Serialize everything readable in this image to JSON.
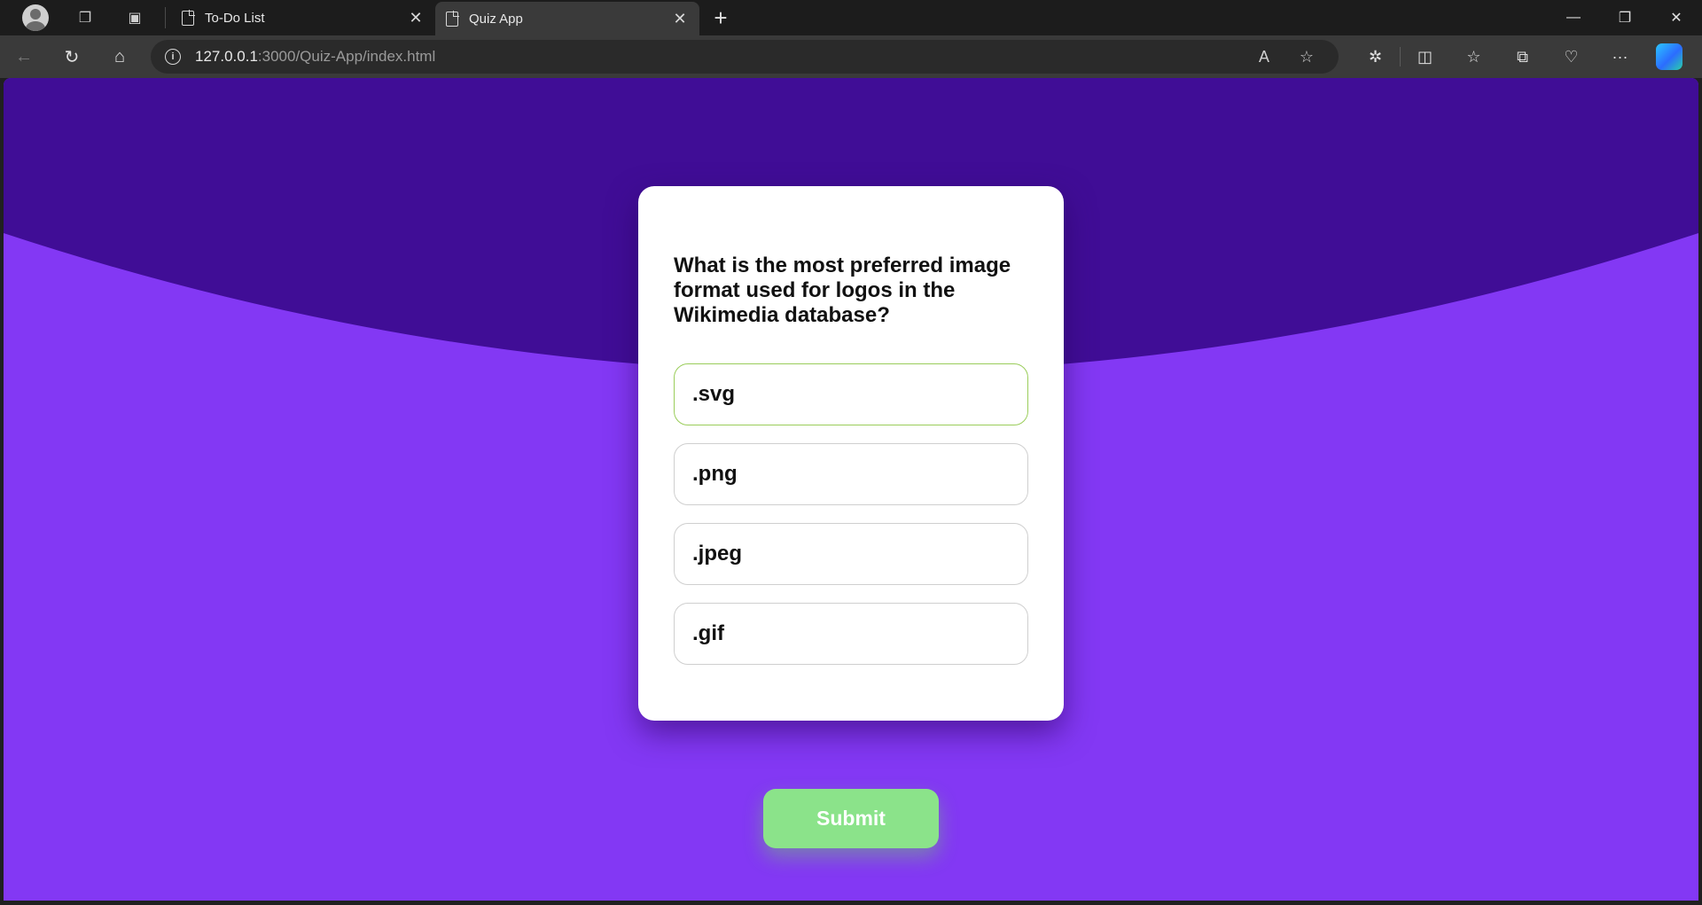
{
  "browser": {
    "tabs": [
      {
        "title": "To-Do List",
        "active": false
      },
      {
        "title": "Quiz App",
        "active": true
      }
    ],
    "new_tab_symbol": "+",
    "close_symbol": "✕",
    "address": {
      "host": "127.0.0.1",
      "path": ":3000/Quiz-App/index.html"
    },
    "icons": [
      "profile-icon",
      "workspaces-icon",
      "tab-actions-icon",
      "back-icon",
      "refresh-icon",
      "home-icon",
      "site-info-icon",
      "read-aloud-icon",
      "favorite-star-icon",
      "extensions-icon",
      "split-screen-icon",
      "favorites-icon",
      "collections-icon",
      "browser-essentials-icon",
      "more-icon",
      "copilot-icon"
    ]
  },
  "page": {
    "background_color": "#8338f4",
    "wave_color": "#400d96",
    "question": "What is the most preferred image format used for logos in the Wikimedia database?",
    "answers": [
      ".svg",
      ".png",
      ".jpeg",
      ".gif"
    ],
    "hovered_answer": ".svg",
    "submit_label": "Submit",
    "submit_color": "#8be38a"
  }
}
